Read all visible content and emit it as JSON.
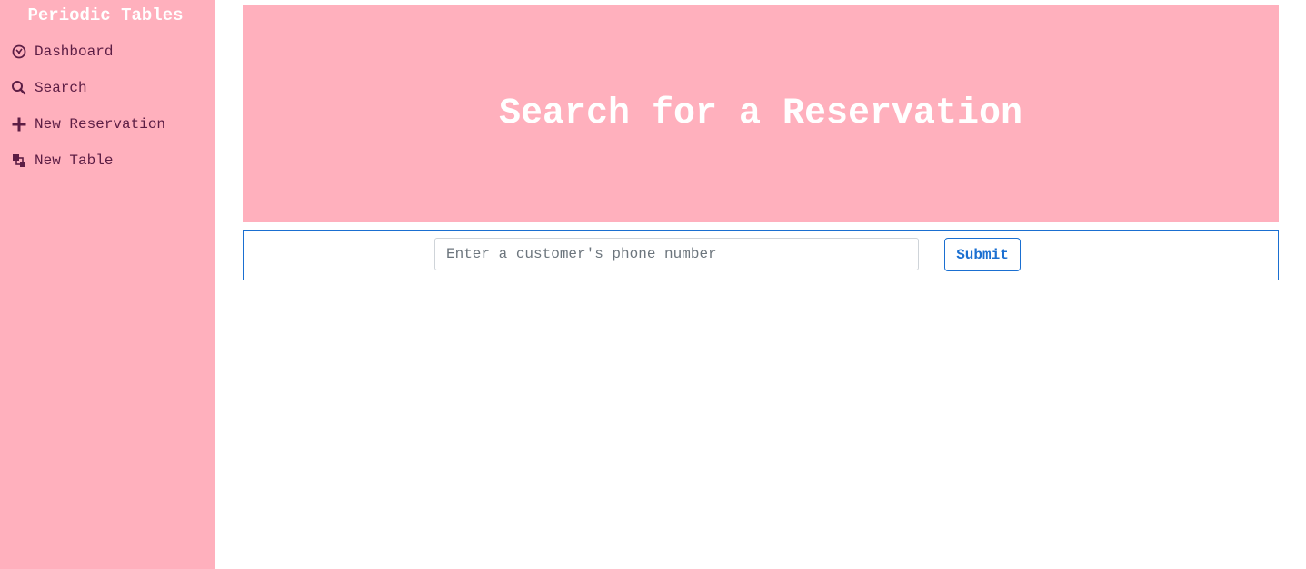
{
  "sidebar": {
    "brand": "Periodic Tables",
    "items": [
      {
        "label": "Dashboard",
        "icon": "dashboard-icon"
      },
      {
        "label": "Search",
        "icon": "search-icon"
      },
      {
        "label": "New Reservation",
        "icon": "plus-icon"
      },
      {
        "label": "New Table",
        "icon": "layers-icon"
      }
    ]
  },
  "main": {
    "title": "Search for a Reservation",
    "search": {
      "placeholder": "Enter a customer's phone number",
      "value": "",
      "submit_label": "Submit"
    }
  },
  "colors": {
    "sidebar_bg": "#ffb0bd",
    "nav_text": "#5c1d44",
    "accent": "#1a6fd1"
  }
}
